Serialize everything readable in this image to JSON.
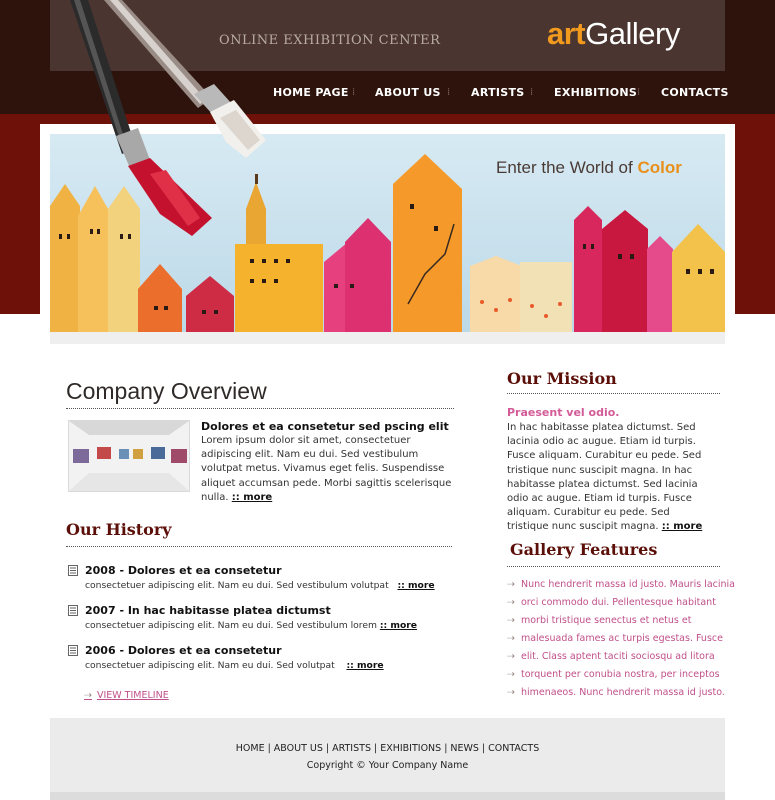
{
  "header": {
    "tagline": "ONLINE EXHIBITION CENTER",
    "logo_part1": "art",
    "logo_part2": "Gallery",
    "nav": [
      "HOME PAGE",
      "ABOUT US",
      "ARTISTS",
      "EXHIBITIONS",
      "CONTACTS"
    ]
  },
  "banner": {
    "title_prefix": "Enter the World of",
    "title_emph": "Color"
  },
  "overview": {
    "heading": "Company Overview",
    "article_title": "Dolores et ea consetetur sed pscing elit",
    "article_text": "Lorem ipsum dolor sit amet, consectetuer adipiscing elit. Nam eu dui. Sed vestibulum volutpat metus. Vivamus eget felis. Suspendisse aliquet accumsan pede. Morbi sagittis scelerisque nulla.",
    "more": ":: more"
  },
  "history": {
    "heading": "Our History",
    "items": [
      {
        "title": "2008 - Dolores et ea consetetur",
        "text": "consectetuer adipiscing elit. Nam eu dui. Sed vestibulum volutpat",
        "more": ":: more"
      },
      {
        "title": "2007 - In hac habitasse platea dictumst",
        "text": "consectetuer adipiscing elit. Nam eu dui. Sed vestibulum lorem",
        "more": ":: more"
      },
      {
        "title": "2006 - Dolores et ea consetetur",
        "text": "consectetuer adipiscing elit. Nam eu dui. Sed volutpat",
        "more": ":: more"
      }
    ],
    "view_timeline": "VIEW TIMELINE"
  },
  "mission": {
    "heading": "Our Mission",
    "subtitle": "Praesent vel odio.",
    "text": "In hac habitasse platea dictumst. Sed lacinia odio ac augue. Etiam id turpis. Fusce aliquam. Curabitur eu pede. Sed tristique nunc suscipit magna. In hac habitasse platea dictumst. Sed lacinia odio ac augue. Etiam id turpis. Fusce aliquam. Curabitur eu pede. Sed tristique nunc suscipit magna.",
    "more": ":: more"
  },
  "features": {
    "heading": "Gallery Features",
    "items": [
      "Nunc hendrerit massa id justo. Mauris lacinia",
      "orci commodo dui. Pellentesque habitant",
      "morbi tristique senectus et netus et",
      "malesuada fames ac turpis egestas. Fusce",
      "elit. Class aptent taciti sociosqu ad litora",
      "torquent per conubia nostra, per inceptos",
      "himenaeos.  Nunc hendrerit massa id justo."
    ]
  },
  "footer": {
    "links": [
      "HOME",
      "ABOUT US",
      "ARTISTS",
      "EXHIBITIONS",
      "NEWS",
      "CONTACTS"
    ],
    "copyright": "Copyright © Your Company Name"
  },
  "colors": {
    "header_dark": "#2e130c",
    "header_panel": "#4b3530",
    "band_red": "#6e1109",
    "accent_orange": "#f29a1e",
    "heading_maroon": "#5b0f08",
    "link_pink": "#c0508a"
  }
}
